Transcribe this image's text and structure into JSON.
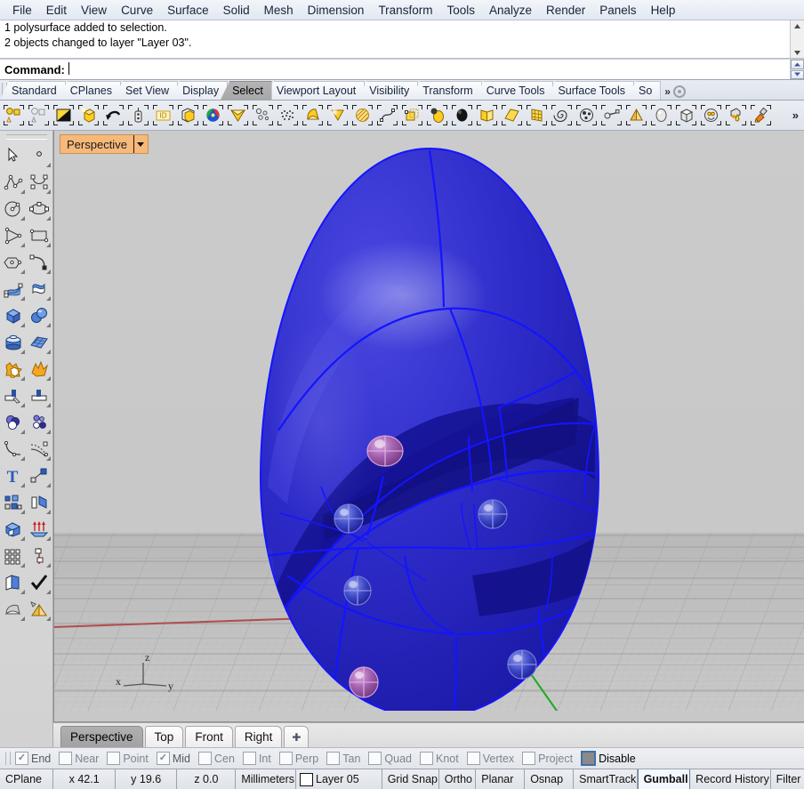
{
  "app": {
    "title": "Rhinoceros",
    "accent_orange": "#f6b97a",
    "model_blue": "#2a28c8",
    "edge_blue": "#1414ff",
    "bump_purple": "#a85fb0"
  },
  "menubar": {
    "items": [
      {
        "label": "File"
      },
      {
        "label": "Edit"
      },
      {
        "label": "View"
      },
      {
        "label": "Curve"
      },
      {
        "label": "Surface"
      },
      {
        "label": "Solid"
      },
      {
        "label": "Mesh"
      },
      {
        "label": "Dimension"
      },
      {
        "label": "Transform"
      },
      {
        "label": "Tools"
      },
      {
        "label": "Analyze"
      },
      {
        "label": "Render"
      },
      {
        "label": "Panels"
      },
      {
        "label": "Help"
      }
    ]
  },
  "command_area": {
    "history": [
      "1 polysurface added to selection.",
      "2 objects changed to layer \"Layer 03\"."
    ],
    "prompt_label": "Command:",
    "prompt_value": "",
    "scroll_up_icon": "scroll-up-arrow",
    "scroll_down_icon": "scroll-down-arrow"
  },
  "toolbar_tabs": {
    "items": [
      {
        "label": "Standard",
        "active": false
      },
      {
        "label": "CPlanes",
        "active": false
      },
      {
        "label": "Set View",
        "active": false
      },
      {
        "label": "Display",
        "active": false
      },
      {
        "label": "Select",
        "active": true
      },
      {
        "label": "Viewport Layout",
        "active": false
      },
      {
        "label": "Visibility",
        "active": false
      },
      {
        "label": "Transform",
        "active": false
      },
      {
        "label": "Curve Tools",
        "active": false
      },
      {
        "label": "Surface Tools",
        "active": false
      },
      {
        "label": "So",
        "active": false
      }
    ],
    "overflow_label": "»",
    "options_icon": "gear-icon"
  },
  "icon_toolbar": {
    "overflow_label": "»",
    "icons": [
      {
        "name": "select-points-icon"
      },
      {
        "name": "deselect-points-icon"
      },
      {
        "name": "invert-selection-icon"
      },
      {
        "name": "select-last-created-icon"
      },
      {
        "name": "select-previous-icon"
      },
      {
        "name": "select-by-clipping-icon"
      },
      {
        "name": "select-by-name-icon"
      },
      {
        "name": "select-by-layer-icon"
      },
      {
        "name": "select-by-color-icon"
      },
      {
        "name": "select-surfaces-icon"
      },
      {
        "name": "select-small-objects-icon"
      },
      {
        "name": "select-points-cloud-icon"
      },
      {
        "name": "select-polysurfaces-icon"
      },
      {
        "name": "select-surface-icon"
      },
      {
        "name": "select-hatch-icon"
      },
      {
        "name": "select-curves-icon"
      },
      {
        "name": "select-blocks-icon"
      },
      {
        "name": "select-spheres-icon"
      },
      {
        "name": "select-meshes-icon"
      },
      {
        "name": "select-open-surfaces-icon"
      },
      {
        "name": "select-planar-surfaces-icon"
      },
      {
        "name": "select-grid-surfaces-icon"
      },
      {
        "name": "select-spirals-icon"
      },
      {
        "name": "select-groups-icon"
      },
      {
        "name": "select-light-icon"
      },
      {
        "name": "select-cone-icon"
      },
      {
        "name": "select-ellipsoid-icon"
      },
      {
        "name": "select-box-icon"
      },
      {
        "name": "select-annotation-icon"
      },
      {
        "name": "select-material-icon"
      },
      {
        "name": "select-paint-icon"
      }
    ]
  },
  "sidebar": {
    "icons": [
      {
        "name": "pointer-select-icon"
      },
      {
        "name": "point-object-icon"
      },
      {
        "name": "polyline-icon"
      },
      {
        "name": "control-point-curve-icon"
      },
      {
        "name": "circle-icon"
      },
      {
        "name": "ellipse-icon"
      },
      {
        "name": "polygon-triangle-icon"
      },
      {
        "name": "rectangle-icon"
      },
      {
        "name": "hexagon-icon"
      },
      {
        "name": "arc-icon"
      },
      {
        "name": "surface-control-points-icon"
      },
      {
        "name": "extrude-surface-icon"
      },
      {
        "name": "box-solid-icon"
      },
      {
        "name": "sphere-solid-icon"
      },
      {
        "name": "cylinder-solid-icon"
      },
      {
        "name": "surface-grid-icon"
      },
      {
        "name": "boolean-union-icon"
      },
      {
        "name": "explode-icon"
      },
      {
        "name": "trim-icon"
      },
      {
        "name": "split-icon"
      },
      {
        "name": "boolean-spheres-icon"
      },
      {
        "name": "point-cloud-icon"
      },
      {
        "name": "fillet-curve-icon"
      },
      {
        "name": "offset-curve-icon"
      },
      {
        "name": "text-tool-icon"
      },
      {
        "name": "scale-icon"
      },
      {
        "name": "array-icon"
      },
      {
        "name": "rotate-icon"
      },
      {
        "name": "cap-solid-icon"
      },
      {
        "name": "extrude-up-icon"
      },
      {
        "name": "grid-array-icon"
      },
      {
        "name": "analyze-direction-icon"
      },
      {
        "name": "open-book-surface-icon"
      },
      {
        "name": "check-mark-icon"
      },
      {
        "name": "mesh-tools-icon"
      },
      {
        "name": "render-pyramid-icon"
      }
    ]
  },
  "viewport": {
    "label": "Perspective",
    "dropdown_icon": "chevron-down-icon",
    "axis_labels": {
      "x": "x",
      "y": "y",
      "z": "z"
    },
    "axis_colors": {
      "x": "#b05050",
      "y": "#22aa22",
      "z": "#555555"
    },
    "background_color": "#c8c8c8",
    "ground_color": "#c0c0c0",
    "model": {
      "name": "faceted-egg-polysurface",
      "body_color": "#2a28c8",
      "edge_color": "#1414ff",
      "bumps": [
        {
          "color": "#a85fb0"
        },
        {
          "color": "#3a44c0"
        },
        {
          "color": "#3a44c0"
        },
        {
          "color": "#3a44c0"
        },
        {
          "color": "#a85fb0"
        },
        {
          "color": "#3a44c0"
        },
        {
          "color": "#a85fb0"
        }
      ]
    }
  },
  "viewport_tabs": {
    "items": [
      {
        "label": "Perspective",
        "active": true
      },
      {
        "label": "Top",
        "active": false
      },
      {
        "label": "Front",
        "active": false
      },
      {
        "label": "Right",
        "active": false
      }
    ],
    "add_label": "✚",
    "add_icon": "add-viewport-icon"
  },
  "osnap_bar": {
    "items": [
      {
        "label": "End",
        "checked": true
      },
      {
        "label": "Near",
        "checked": false
      },
      {
        "label": "Point",
        "checked": false
      },
      {
        "label": "Mid",
        "checked": true
      },
      {
        "label": "Cen",
        "checked": false
      },
      {
        "label": "Int",
        "checked": false
      },
      {
        "label": "Perp",
        "checked": false
      },
      {
        "label": "Tan",
        "checked": false
      },
      {
        "label": "Quad",
        "checked": false
      },
      {
        "label": "Knot",
        "checked": false
      },
      {
        "label": "Vertex",
        "checked": false
      },
      {
        "label": "Project",
        "checked": false
      },
      {
        "label": "Disable",
        "checked": false,
        "highlight": true
      }
    ],
    "check_glyph": "✓"
  },
  "status_bar": {
    "cplane": "CPlane",
    "x": "x 42.1",
    "y": "y 19.6",
    "z": "z 0.0",
    "units": "Millimeters",
    "layer": "Layer 05",
    "layer_color": "#ffffff",
    "toggles": [
      {
        "label": "Grid Snap",
        "active": false
      },
      {
        "label": "Ortho",
        "active": false
      },
      {
        "label": "Planar",
        "active": false
      },
      {
        "label": "Osnap",
        "active": false
      },
      {
        "label": "SmartTrack",
        "active": false
      },
      {
        "label": "Gumball",
        "active": true
      },
      {
        "label": "Record History",
        "active": false
      },
      {
        "label": "Filter",
        "active": false
      }
    ]
  }
}
